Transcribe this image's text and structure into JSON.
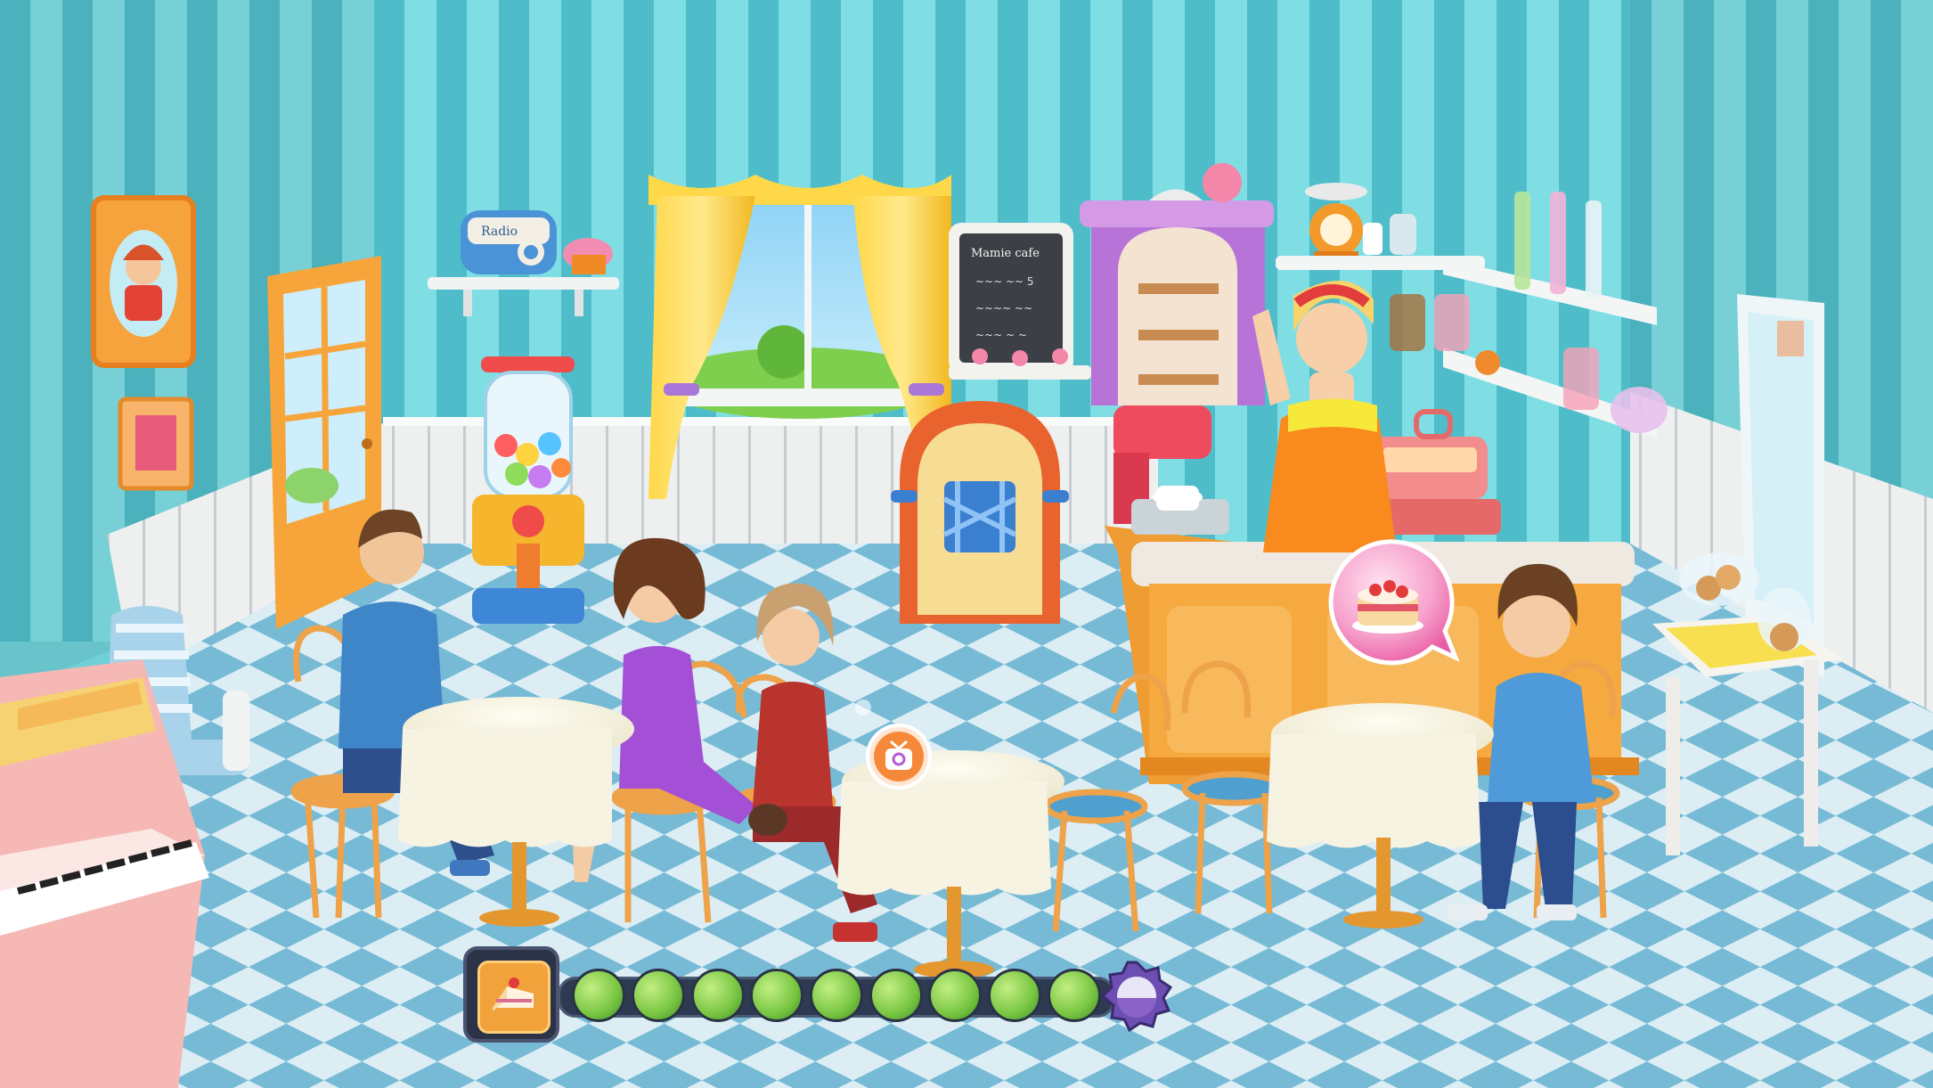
{
  "game": {
    "name": "cafe-restaurant-scene",
    "chalkboard": {
      "title": "Mamie cafe",
      "lines": [
        "~~~ ~~ 5",
        "~~~~ ~~",
        "~~~ ~ ~"
      ]
    },
    "radio_label": "Radio",
    "order_bubble": {
      "item": "strawberry-cake-icon"
    },
    "tv_bubble": {
      "item": "tv-ad-icon"
    },
    "progress": {
      "filled_segments": 9,
      "total_segments": 9,
      "level_icon": "cake-slice-icon",
      "goal_icon": "purple-badge-icon"
    }
  },
  "colors": {
    "wall_stripe_light": "#7fdde4",
    "wall_stripe_dark": "#4fbdc9",
    "floor_light": "#d9edf3",
    "floor_dark": "#6cb5d3",
    "counter_orange": "#f3a43c",
    "progress_green": "#77c541",
    "goal_purple": "#8b63c7",
    "bubble_pink": "#f17ab8"
  }
}
